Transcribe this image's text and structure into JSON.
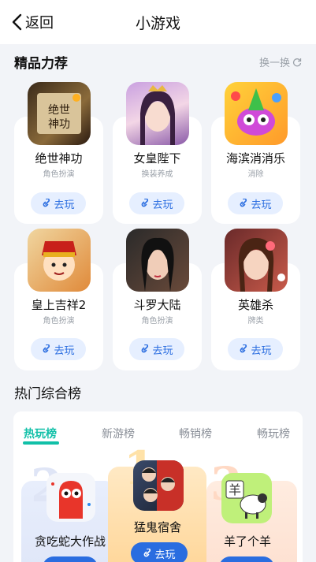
{
  "header": {
    "back_label": "返回",
    "title": "小游戏"
  },
  "featured": {
    "title": "精品力荐",
    "refresh_label": "换一换",
    "play_label": "去玩",
    "games": [
      {
        "name": "绝世神功",
        "category": "角色扮演",
        "icon": "scroll-book-icon"
      },
      {
        "name": "女皇陛下",
        "category": "换装养成",
        "icon": "empress-portrait-icon"
      },
      {
        "name": "海滨消消乐",
        "category": "消除",
        "icon": "owl-fruit-icon"
      },
      {
        "name": "皇上吉祥2",
        "category": "角色扮演",
        "icon": "emperor-cartoon-icon"
      },
      {
        "name": "斗罗大陆",
        "category": "角色扮演",
        "icon": "heroine-portrait-icon"
      },
      {
        "name": "英雄杀",
        "category": "牌类",
        "icon": "lady-portrait-icon"
      }
    ]
  },
  "ranking": {
    "title": "热门综合榜",
    "tabs": [
      "热玩榜",
      "新游榜",
      "畅销榜",
      "畅玩榜"
    ],
    "active_tab": "热玩榜",
    "play_label": "去玩",
    "podium": [
      {
        "rank": "2",
        "name": "贪吃蛇大作战",
        "icon": "red-snake-icon"
      },
      {
        "rank": "1",
        "name": "猛鬼宿舍",
        "icon": "dorm-ghost-icon"
      },
      {
        "rank": "3",
        "name": "羊了个羊",
        "icon": "sheep-icon"
      }
    ]
  },
  "colors": {
    "accent": "#11c0a8",
    "primary": "#2a6de0",
    "background": "#f2f4f8"
  }
}
